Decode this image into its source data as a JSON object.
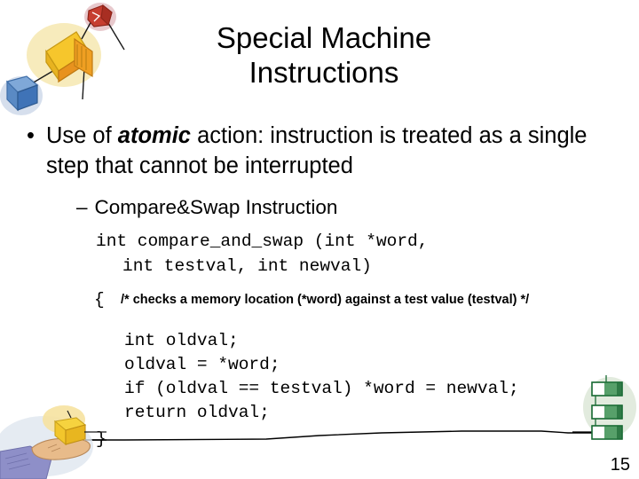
{
  "slide": {
    "title": "Special Machine\nInstructions",
    "page_number": "15",
    "background_color": "#ffffff",
    "text_color": "#000000"
  },
  "bullet": {
    "marker": "•",
    "text_before_emph": "Use of ",
    "emph": "atomic",
    "text_after_emph": " action: instruction is treated as a single step that cannot be interrupted"
  },
  "sub_bullet": {
    "dash": "–",
    "label": "Compare&Swap Instruction"
  },
  "code": {
    "signature_line_1": "int compare_and_swap (int *word,",
    "signature_line_2": "int testval, int newval)",
    "brace_open": "{",
    "comment": "/* checks a memory location (*word) against a test value (testval) */",
    "body_line_1": "int oldval;",
    "body_line_2": "oldval = *word;",
    "body_line_3": "if (oldval == testval) *word = newval;",
    "body_line_4": "return oldval;",
    "brace_close": "}"
  },
  "artwork": {
    "top_left_name": "boxes-network-clipart",
    "bottom_left_name": "hand-holding-box-clipart",
    "right_name": "green-boxes-stack-clipart",
    "connector_line_name": "wavy-connector-line",
    "colors": {
      "yellow_box": "#f2c230",
      "yellow_box_light": "#f7d878",
      "orange_box": "#e8921e",
      "red_cube": "#c0392b",
      "red_halo": "#e8c0c4",
      "blue_box": "#4a7fc1",
      "blue_box_light": "#8fb4de",
      "green_box": "#4f9e63",
      "green_halo": "#dfe9da",
      "skin": "#e8bb8a",
      "sleeve": "#8e8fc8",
      "yellow_halo": "#f6e2a0"
    }
  }
}
